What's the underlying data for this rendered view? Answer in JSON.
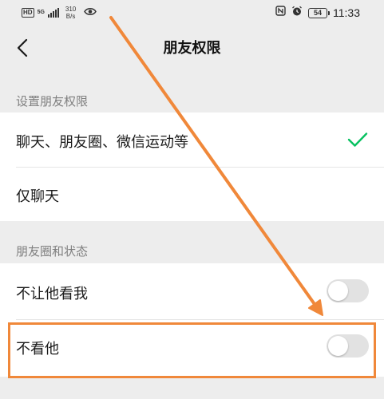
{
  "status_bar": {
    "network_hd": "HD",
    "network_5g": "5G",
    "speed_value": "310",
    "speed_unit": "B/s",
    "battery": "54",
    "time": "11:33"
  },
  "nav": {
    "title": "朋友权限"
  },
  "sections": {
    "permissions": {
      "label": "设置朋友权限",
      "options": [
        {
          "label": "聊天、朋友圈、微信运动等",
          "selected": true
        },
        {
          "label": "仅聊天",
          "selected": false
        }
      ]
    },
    "moments": {
      "label": "朋友圈和状态",
      "toggles": [
        {
          "label": "不让他看我",
          "on": false
        },
        {
          "label": "不看他",
          "on": false
        }
      ]
    }
  },
  "colors": {
    "accent": "#07c160",
    "annotation": "#f0883a",
    "background": "#ededed"
  },
  "icons": {
    "back": "chevron-left-icon",
    "check": "checkmark-icon"
  }
}
